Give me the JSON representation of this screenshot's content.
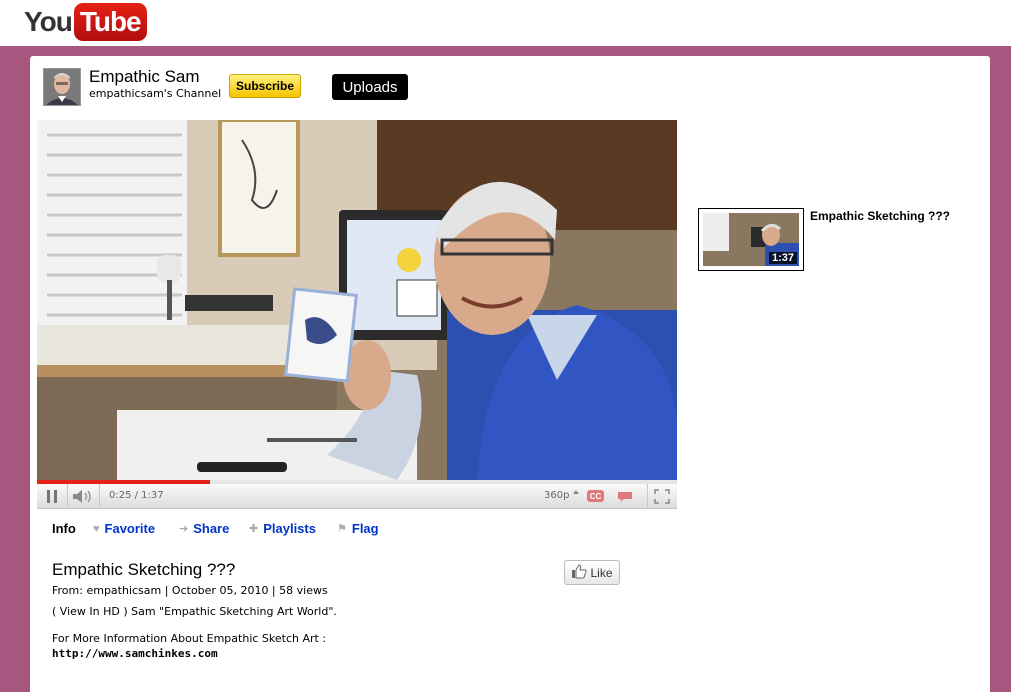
{
  "logo": {
    "you": "You",
    "tube": "Tube"
  },
  "channel": {
    "name": "Empathic Sam",
    "subtitle": "empathicsam's Channel",
    "subscribe_label": "Subscribe",
    "uploads_label": "Uploads"
  },
  "player": {
    "time_readout": "0:25 / 1:37",
    "quality": "360p",
    "cc_label": "CC",
    "progress": 0.27
  },
  "tabs": [
    {
      "label": "Info",
      "icon": "",
      "active": true
    },
    {
      "label": "Favorite",
      "icon": "heart-icon"
    },
    {
      "label": "Share",
      "icon": "arrow-right-icon"
    },
    {
      "label": "Playlists",
      "icon": "plus-icon"
    },
    {
      "label": "Flag",
      "icon": "flag-icon"
    }
  ],
  "video": {
    "title": "Empathic Sketching ???",
    "meta": "From: empathicsam | October 05, 2010  | 58 views",
    "description_line1": "( View In HD ) Sam \"Empathic Sketching Art World\".",
    "description_line2": "For More Information About Empathic Sketch Art :",
    "description_link": "http://www.samchinkes.com",
    "like_label": "Like"
  },
  "related": [
    {
      "title": "Empathic Sketching ???",
      "duration": "1:37"
    }
  ],
  "colors": {
    "page_background": "#a7567f",
    "link": "#0033cc",
    "progress": "#e62117",
    "subscribe": "#f5c400"
  }
}
